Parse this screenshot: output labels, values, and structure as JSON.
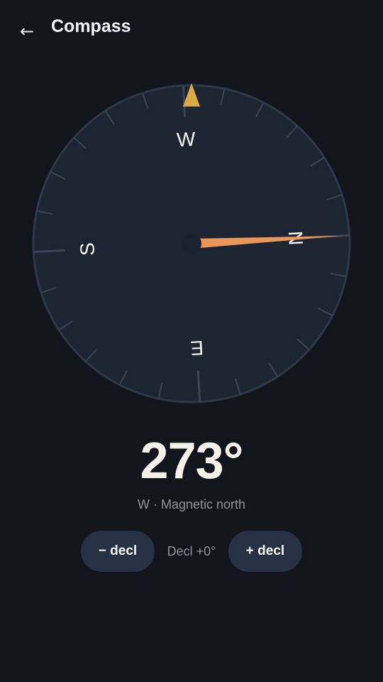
{
  "header": {
    "back_glyph": "←",
    "back_icon": "arrow-left-icon",
    "title": "Compass"
  },
  "compass": {
    "heading_deg": 273,
    "cardinals": {
      "north": "N",
      "east": "E",
      "south": "S",
      "west": "W"
    },
    "colors": {
      "dial": "#1e2532",
      "dial_border": "#2f3848",
      "tick": "#3a4454",
      "needle": "#e8965a",
      "lubber": "#d9a94a",
      "hub": "#1a2230"
    }
  },
  "reading": {
    "value": "273°",
    "caption": "W · Magnetic north"
  },
  "declination": {
    "minus_label": "− decl",
    "readout": "Decl +0°",
    "plus_label": "+ decl"
  }
}
